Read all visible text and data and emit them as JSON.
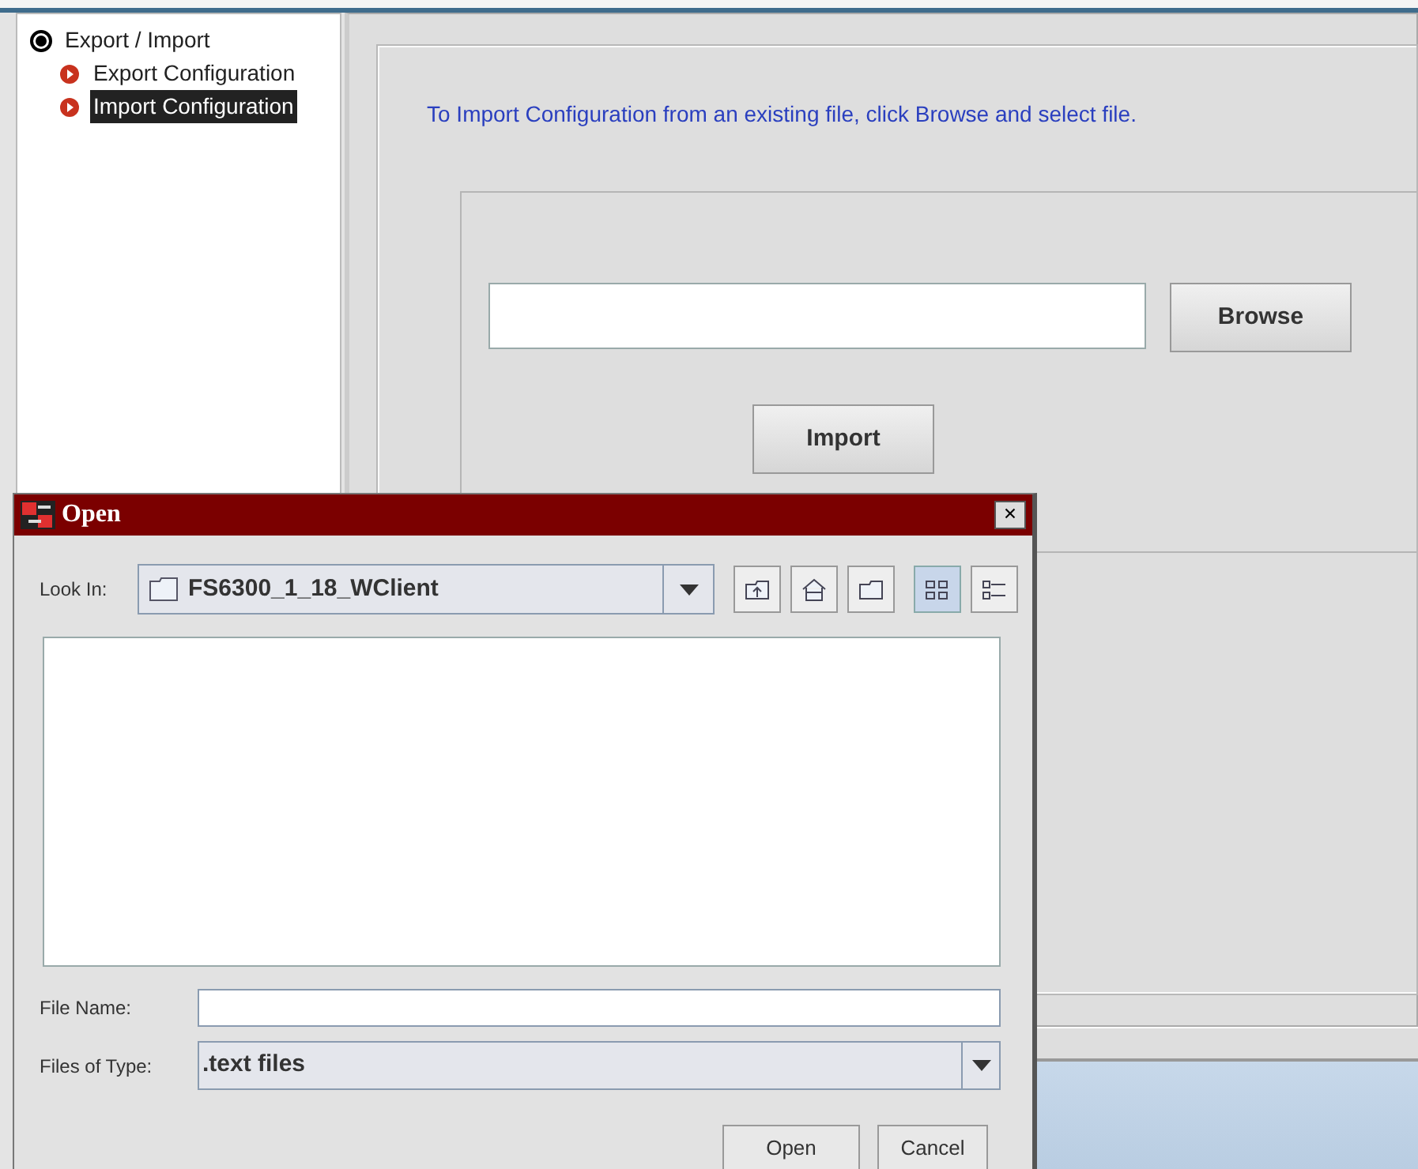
{
  "tree": {
    "label": "Export / Import",
    "children": [
      {
        "label": "Export Configuration",
        "selected": false
      },
      {
        "label": "Import Configuration",
        "selected": true
      }
    ]
  },
  "main": {
    "instruction": "To Import Configuration from an existing file, click Browse and select file.",
    "browse_button": "Browse",
    "import_button": "Import"
  },
  "dialog": {
    "title": "Open",
    "close_button": "×",
    "look_in": {
      "label": "Look In:",
      "value": "FS6300_1_18_WClient"
    },
    "toolbar": [
      {
        "kind": "up",
        "selected": false
      },
      {
        "kind": "home",
        "selected": false
      },
      {
        "kind": "new-folder",
        "selected": false
      },
      {
        "kind": "list",
        "selected": true
      },
      {
        "kind": "details",
        "selected": false
      }
    ],
    "file_name": {
      "label": "File Name:"
    },
    "file_type": {
      "label": "Files of Type:",
      "value": ".text files"
    },
    "buttons": [
      "Open",
      "Cancel"
    ]
  }
}
